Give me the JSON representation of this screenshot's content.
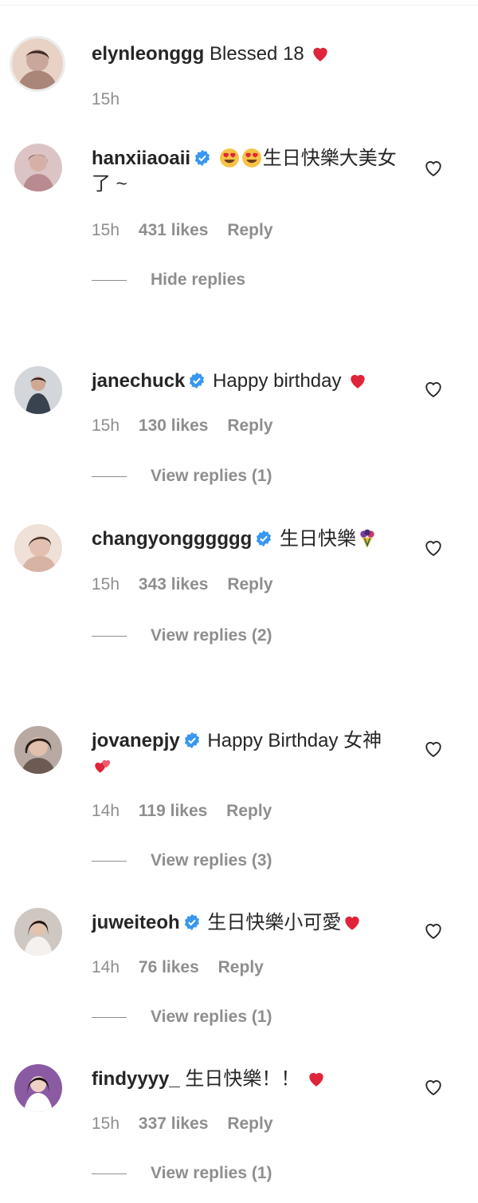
{
  "comments": [
    {
      "username": "elynleonggg",
      "text": "Blessed 18",
      "time": "15h",
      "likes": "",
      "reply_label": "",
      "replies_label": "",
      "avatar_color": "#c9a79a",
      "verified": false
    },
    {
      "username": "hanxiiaoaii",
      "text_after_emoji": "生日快樂大美女了 ~",
      "time": "15h",
      "likes": "431 likes",
      "reply_label": "Reply",
      "replies_label": "Hide replies",
      "avatar_color": "#b98a8f",
      "verified": true
    },
    {
      "username": "janechuck",
      "text": "Happy birthday",
      "time": "15h",
      "likes": "130 likes",
      "reply_label": "Reply",
      "replies_label": "View replies (1)",
      "avatar_color": "#9aa3ad",
      "verified": true
    },
    {
      "username": "changyongggggg",
      "text": "生日快樂",
      "time": "15h",
      "likes": "343 likes",
      "reply_label": "Reply",
      "replies_label": "View replies (2)",
      "avatar_color": "#d7b3a4",
      "verified": true
    },
    {
      "username": "jovanepjy",
      "text": "Happy Birthday 女神",
      "time": "14h",
      "likes": "119 likes",
      "reply_label": "Reply",
      "replies_label": "View replies (3)",
      "avatar_color": "#6d5a52",
      "verified": true
    },
    {
      "username": "juweiteoh",
      "text": "生日快樂小可愛",
      "time": "14h",
      "likes": "76 likes",
      "reply_label": "Reply",
      "replies_label": "View replies (1)",
      "avatar_color": "#5b4d47",
      "verified": true
    },
    {
      "username": "findyyyy_",
      "text": "生日快樂！！",
      "time": "15h",
      "likes": "337 likes",
      "reply_label": "Reply",
      "replies_label": "View replies (1)",
      "avatar_color": "#7a4a8c",
      "verified": false
    }
  ],
  "colors": {
    "verified_blue": "#3897f0",
    "heart_red": "#ed4956",
    "meta_gray": "#8e8e8e"
  },
  "icons": {
    "verified": "verified-badge-icon",
    "like": "heart-outline-icon",
    "emoji_heart": "red-heart-emoji",
    "emoji_eyes": "heart-eyes-emoji",
    "emoji_bouquet": "bouquet-emoji"
  }
}
